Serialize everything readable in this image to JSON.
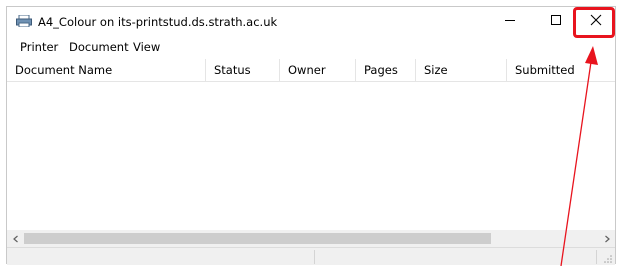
{
  "window": {
    "title": "A4_Colour on its-printstud.ds.strath.ac.uk",
    "controls": {
      "minimize": "minimize-icon",
      "maximize": "maximize-icon",
      "close": "close-icon"
    }
  },
  "menu": [
    "Printer",
    "Document",
    "View"
  ],
  "columns": [
    "Document Name",
    "Status",
    "Owner",
    "Pages",
    "Size",
    "Submitted"
  ],
  "rows": [],
  "annotation": {
    "color": "#e8141e",
    "target": "close-button"
  },
  "colors": {
    "scroll_track": "#f0f0f0",
    "scroll_thumb": "#cdcdcd"
  }
}
